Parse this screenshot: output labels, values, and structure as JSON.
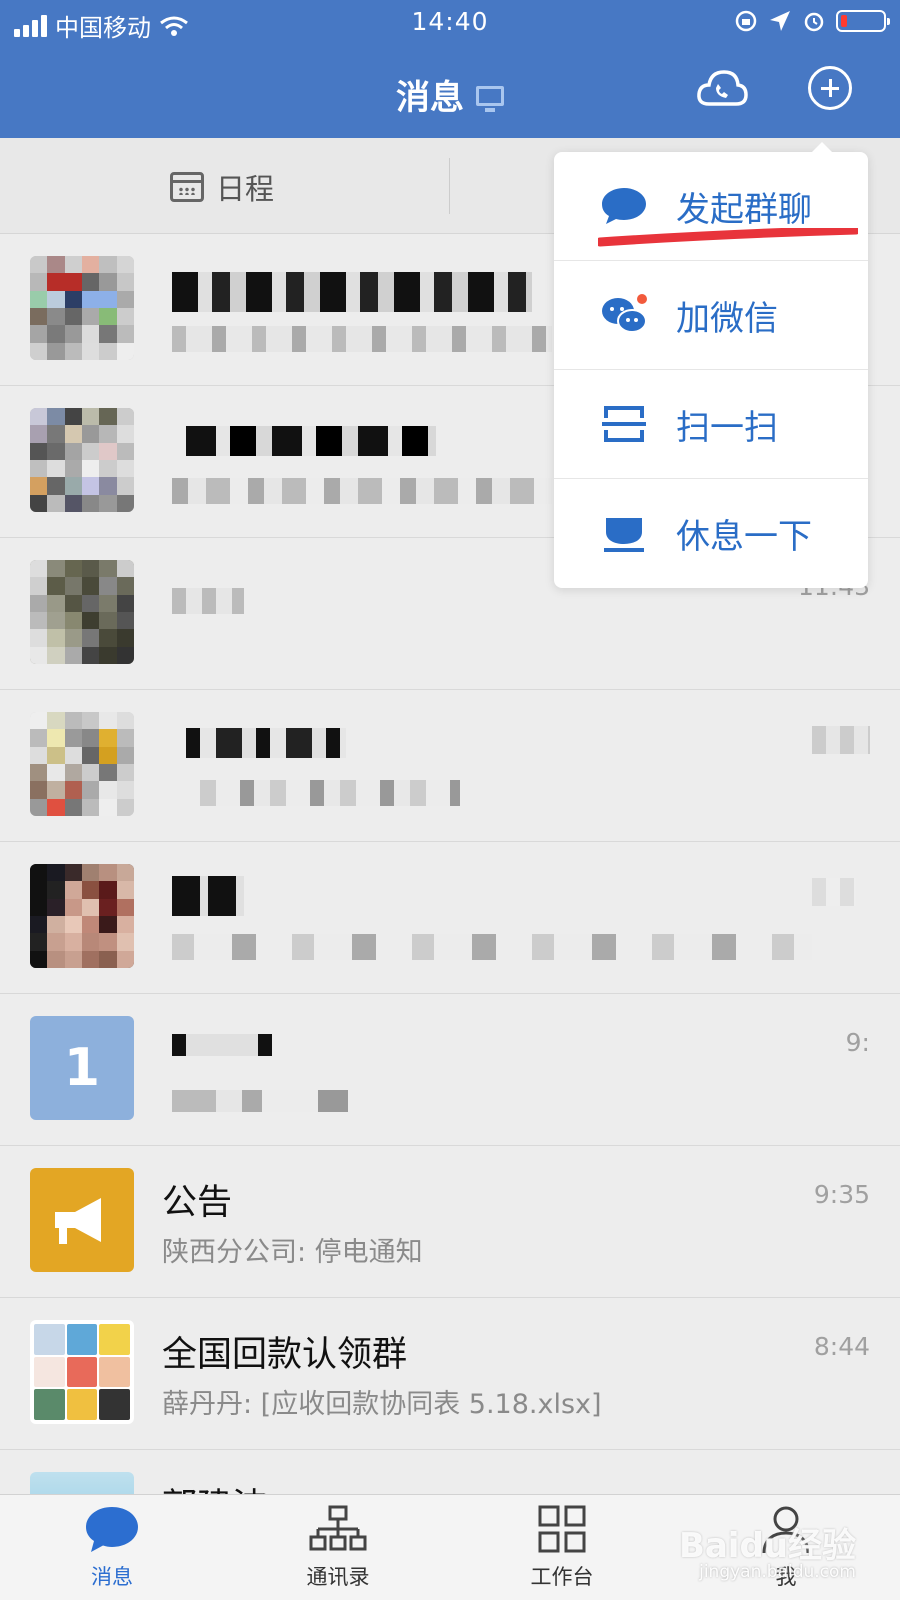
{
  "status_bar": {
    "carrier": "中国移动",
    "time": "14:40"
  },
  "header": {
    "title": "消息"
  },
  "quick_bar": {
    "schedule_label": "日程"
  },
  "popover_menu": {
    "items": [
      {
        "label": "发起群聊",
        "icon": "chat-bubble-icon"
      },
      {
        "label": "加微信",
        "icon": "wechat-icon"
      },
      {
        "label": "扫一扫",
        "icon": "scan-icon"
      },
      {
        "label": "休息一下",
        "icon": "rest-icon"
      }
    ]
  },
  "chats": [
    {
      "name": "",
      "preview": "",
      "time": ""
    },
    {
      "name": "",
      "preview": "",
      "time": ""
    },
    {
      "name": "",
      "preview": "",
      "time": "11:43"
    },
    {
      "name": "",
      "preview": "",
      "time": ""
    },
    {
      "name": "",
      "preview": "",
      "time": ""
    },
    {
      "name": "",
      "preview": "",
      "time": "9:"
    },
    {
      "name": "公告",
      "preview": "陕西分公司: 停电通知",
      "time": "9:35"
    },
    {
      "name": "全国回款认领群",
      "preview": "薛丹丹: [应收回款协同表 5.18.xlsx]",
      "time": "8:44"
    },
    {
      "name": "郭建波",
      "preview": "",
      "time": ""
    }
  ],
  "tab_bar": {
    "tabs": [
      {
        "label": "消息"
      },
      {
        "label": "通讯录"
      },
      {
        "label": "工作台"
      },
      {
        "label": "我"
      }
    ]
  },
  "watermark": {
    "brand": "Baidu经验",
    "url": "jingyan.baidu.com"
  },
  "colors": {
    "header_bg": "#4778c4",
    "accent": "#2a6dc6",
    "announce": "#e3a624",
    "highlight_line": "#e8343b"
  }
}
